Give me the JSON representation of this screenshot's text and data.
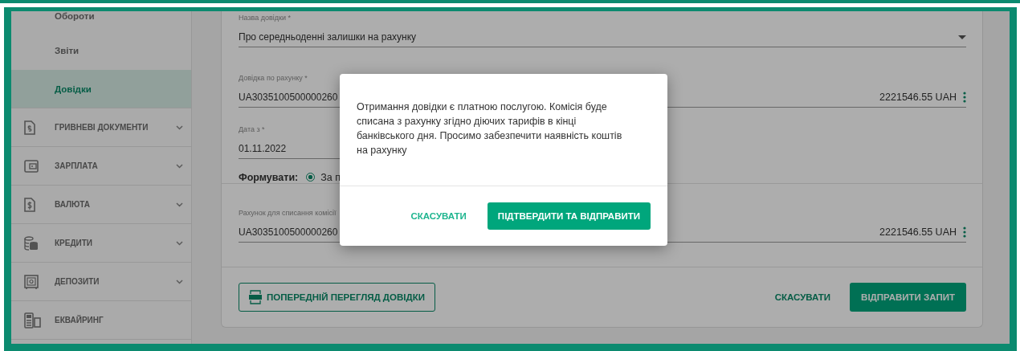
{
  "sidebar": {
    "items": [
      {
        "label": "Обороти",
        "kind": "sub",
        "selected": false
      },
      {
        "label": "Звіти",
        "kind": "sub",
        "selected": false
      },
      {
        "label": "Довідки",
        "kind": "sub",
        "selected": true
      },
      {
        "label": "ГРИВНЕВІ ДОКУМЕНТИ",
        "kind": "section",
        "selected": false,
        "expandable": true
      },
      {
        "label": "ЗАРПЛАТА",
        "kind": "section",
        "selected": false,
        "expandable": true
      },
      {
        "label": "ВАЛЮТА",
        "kind": "section",
        "selected": false,
        "expandable": true
      },
      {
        "label": "КРЕДИТИ",
        "kind": "section",
        "selected": false,
        "expandable": true
      },
      {
        "label": "ДЕПОЗИТИ",
        "kind": "section",
        "selected": false,
        "expandable": true
      },
      {
        "label": "ЕКВАЙРИНГ",
        "kind": "section",
        "selected": false,
        "expandable": false
      }
    ]
  },
  "form": {
    "fields": [
      {
        "kind": "select",
        "label": "Назва довідки *",
        "value": "Про середньоденні залишки на рахунку"
      },
      {
        "kind": "account",
        "label": "Довідка по рахунку *",
        "value": "UA3035100500000260",
        "amount": "2221546.55 UAH"
      },
      {
        "kind": "date",
        "label": "Дата з *",
        "value": "01.11.2022"
      }
    ],
    "generate": {
      "label": "Формувати:",
      "options": [
        {
          "label": "За п",
          "selected": true
        }
      ]
    },
    "fee_account": {
      "kind": "account",
      "label": "Рахунок для списання комісії",
      "value": "UA3035100500000260",
      "amount": "2221546.55 UAH"
    },
    "actions": {
      "preview": "ПОПЕРЕДНІЙ ПЕРЕГЛЯД ДОВІДКИ",
      "cancel": "СКАСУВАТИ",
      "submit": "ВІДПРАВИТИ ЗАПИТ"
    }
  },
  "dialog": {
    "message": "Отримання довідки є платною послугою. Комісія буде списана з рахунку згідно діючих тарифів в кінці банківського дня. Просимо забезпечити наявність коштів на рахунку",
    "cancel": "СКАСУВАТИ",
    "confirm": "ПІДТВЕРДИТИ ТА ВІДПРАВИТИ"
  }
}
